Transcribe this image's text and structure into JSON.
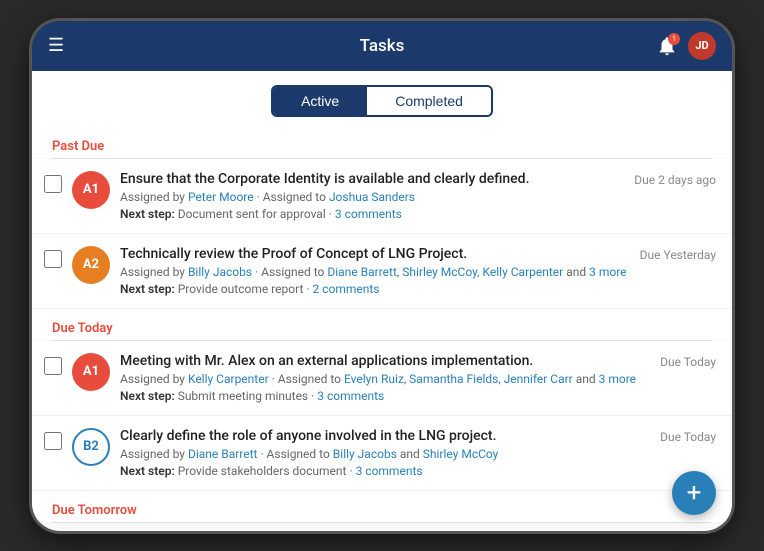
{
  "header": {
    "title": "Tasks",
    "hamburger": "☰",
    "notification_badge": "1"
  },
  "tabs": {
    "active_label": "Active",
    "completed_label": "Completed"
  },
  "sections": [
    {
      "title": "Past Due",
      "tasks": [
        {
          "avatar_label": "A1",
          "avatar_bg": "red",
          "title": "Ensure that the Corporate Identity is available and clearly defined.",
          "assigned_by": "Peter Moore",
          "assigned_to": "Joshua Sanders",
          "next_step_label": "Next step:",
          "next_step": "Document sent for approval",
          "comments_label": "3 comments",
          "due": "Due 2 days ago"
        },
        {
          "avatar_label": "A2",
          "avatar_bg": "orange",
          "title": "Technically review the Proof of Concept of LNG Project.",
          "assigned_by": "Billy Jacobs",
          "assigned_to": "Diane Barrett, Shirley McCoy, Kelly Carpenter",
          "assigned_to_more": "and 3 more",
          "next_step_label": "Next step:",
          "next_step": "Provide outcome report",
          "comments_label": "2 comments",
          "due": "Due Yesterday"
        }
      ]
    },
    {
      "title": "Due Today",
      "tasks": [
        {
          "avatar_label": "A1",
          "avatar_bg": "red",
          "title": "Meeting with Mr. Alex on an external applications implementation.",
          "assigned_by": "Kelly Carpenter",
          "assigned_to": "Evelyn Ruiz, Samantha Fields, Jennifer Carr",
          "assigned_to_more": "and 3 more",
          "next_step_label": "Next step:",
          "next_step": "Submit meeting minutes",
          "comments_label": "3 comments",
          "due": "Due Today"
        },
        {
          "avatar_label": "B2",
          "avatar_bg": "blue",
          "title": "Clearly define the role of anyone involved in the LNG project.",
          "assigned_by": "Diane Barrett",
          "assigned_to": "Billy Jacobs",
          "assigned_to_and": "and",
          "assigned_to_2": "Shirley McCoy",
          "next_step_label": "Next step:",
          "next_step": "Provide stakeholders document",
          "comments_label": "3 comments",
          "due": "Due Today"
        }
      ]
    },
    {
      "title": "Due Tomorrow",
      "tasks": []
    }
  ],
  "fab_label": "+",
  "assigned_by_text": "Assigned by",
  "assigned_to_text": "Assigned to"
}
